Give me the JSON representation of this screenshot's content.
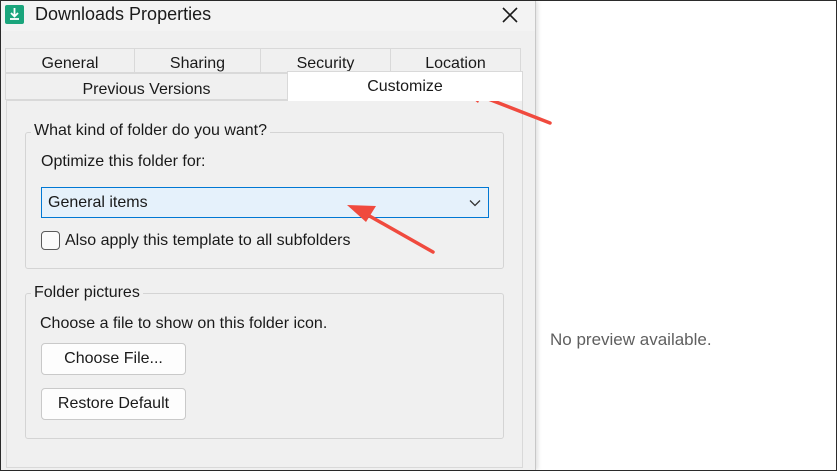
{
  "window": {
    "title": "Downloads Properties",
    "app_icon": "downloads-folder-icon",
    "close_icon": "close-icon"
  },
  "tabs": {
    "row1": [
      {
        "label": "General"
      },
      {
        "label": "Sharing"
      },
      {
        "label": "Security"
      },
      {
        "label": "Location"
      }
    ],
    "row2": [
      {
        "label": "Previous Versions"
      },
      {
        "label": "Customize",
        "active": true
      }
    ]
  },
  "folder_type_group": {
    "label": "What kind of folder do you want?",
    "optimize_label": "Optimize this folder for:",
    "optimize_value": "General items",
    "apply_subfolders_label": "Also apply this template to all subfolders",
    "apply_subfolders_checked": false
  },
  "folder_pictures_group": {
    "label": "Folder pictures",
    "description": "Choose a file to show on this folder icon.",
    "choose_file_label": "Choose File...",
    "restore_default_label": "Restore Default"
  },
  "preview": {
    "text": "No preview available."
  },
  "colors": {
    "accent": "#0078d4",
    "annotation_arrow": "#f04a3e",
    "app_icon": "#1aa57c"
  }
}
